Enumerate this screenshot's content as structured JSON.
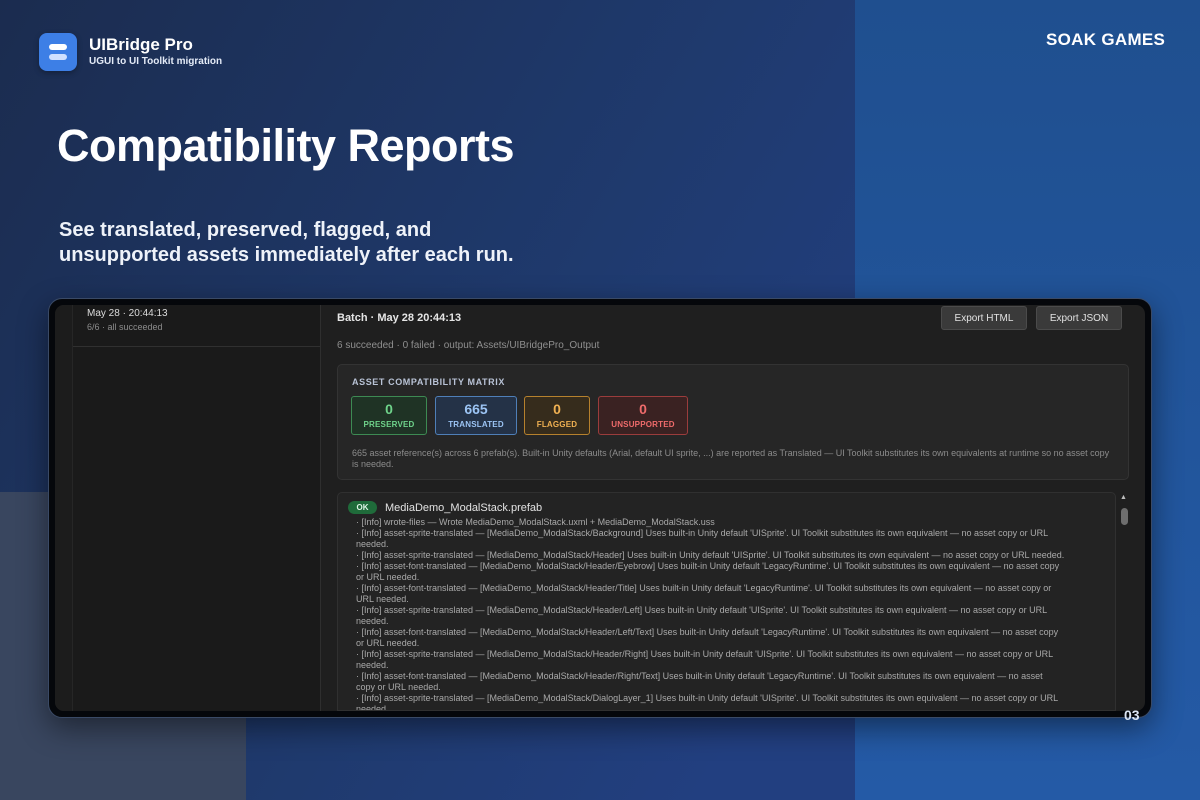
{
  "header": {
    "app_name": "UIBridge Pro",
    "app_subtitle": "UGUI to UI Toolkit migration",
    "brand": "SOAK GAMES"
  },
  "hero": {
    "title": "Compatibility Reports",
    "subtitle_line1": "See translated, preserved, flagged, and",
    "subtitle_line2": "unsupported assets immediately after each run."
  },
  "slide_number": "03",
  "sidebar": {
    "batches": [
      {
        "date": "May 28 · 20:44:13",
        "status": "6/6 · all succeeded"
      }
    ]
  },
  "main": {
    "batch_title": "Batch · May 28 20:44:13",
    "export_html_label": "Export HTML",
    "export_json_label": "Export JSON",
    "summary": "6 succeeded · 0 failed · output: Assets/UIBridgePro_Output"
  },
  "matrix": {
    "title": "ASSET COMPATIBILITY MATRIX",
    "preserved": {
      "value": "0",
      "label": "PRESERVED"
    },
    "translated": {
      "value": "665",
      "label": "TRANSLATED"
    },
    "flagged": {
      "value": "0",
      "label": "FLAGGED"
    },
    "unsupported": {
      "value": "0",
      "label": "UNSUPPORTED"
    },
    "note": "665 asset reference(s) across 6 prefab(s). Built-in Unity defaults (Arial, default UI sprite, ...) are reported as Translated — UI Toolkit substitutes its own equivalents at runtime so no asset copy is needed."
  },
  "log": {
    "badge": "OK",
    "prefab": "MediaDemo_ModalStack.prefab",
    "lines": [
      "· [Info] wrote-files — Wrote MediaDemo_ModalStack.uxml + MediaDemo_ModalStack.uss",
      "· [Info] asset-sprite-translated — [MediaDemo_ModalStack/Background] Uses built-in Unity default 'UISprite'. UI Toolkit substitutes its own equivalent — no asset copy or URL",
      "needed.",
      "· [Info] asset-sprite-translated — [MediaDemo_ModalStack/Header] Uses built-in Unity default 'UISprite'. UI Toolkit substitutes its own equivalent — no asset copy or URL needed.",
      "· [Info] asset-font-translated — [MediaDemo_ModalStack/Header/Eyebrow] Uses built-in Unity default 'LegacyRuntime'. UI Toolkit substitutes its own equivalent — no asset copy",
      "or URL needed.",
      "· [Info] asset-font-translated — [MediaDemo_ModalStack/Header/Title] Uses built-in Unity default 'LegacyRuntime'. UI Toolkit substitutes its own equivalent — no asset copy or",
      "URL needed.",
      "· [Info] asset-sprite-translated — [MediaDemo_ModalStack/Header/Left] Uses built-in Unity default 'UISprite'. UI Toolkit substitutes its own equivalent — no asset copy or URL",
      "needed.",
      "· [Info] asset-font-translated — [MediaDemo_ModalStack/Header/Left/Text] Uses built-in Unity default 'LegacyRuntime'. UI Toolkit substitutes its own equivalent — no asset copy",
      "or URL needed.",
      "· [Info] asset-sprite-translated — [MediaDemo_ModalStack/Header/Right] Uses built-in Unity default 'UISprite'. UI Toolkit substitutes its own equivalent — no asset copy or URL",
      "needed.",
      "· [Info] asset-font-translated — [MediaDemo_ModalStack/Header/Right/Text] Uses built-in Unity default 'LegacyRuntime'. UI Toolkit substitutes its own equivalent — no asset",
      "copy or URL needed.",
      "· [Info] asset-sprite-translated — [MediaDemo_ModalStack/DialogLayer_1] Uses built-in Unity default 'UISprite'. UI Toolkit substitutes its own equivalent — no asset copy or URL",
      "needed."
    ]
  },
  "icons": {
    "logo": "app-logo-icon",
    "scroll_up": "scroll-up-arrow-icon"
  }
}
